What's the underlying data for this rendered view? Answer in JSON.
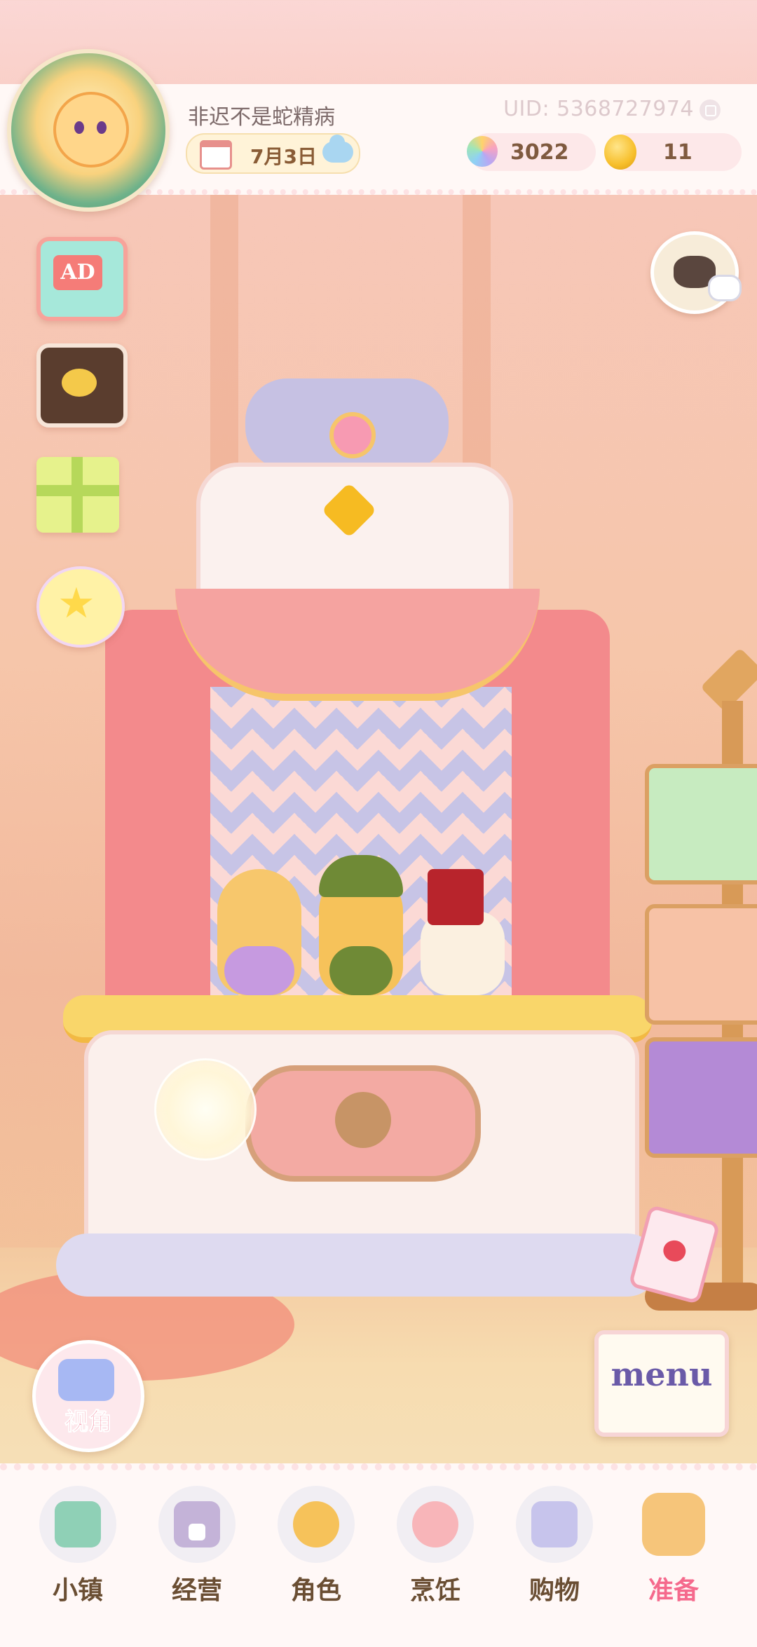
{
  "header": {
    "player_name": "非迟不是蛇精病",
    "uid": "UID: 5368727974",
    "date": "7月3日",
    "gems": "3022",
    "coins": "11"
  },
  "side_buttons": {
    "ad_label": "AD"
  },
  "view_button": {
    "label": "视角"
  },
  "menu_button": {
    "label": "menu"
  },
  "bottom_nav": {
    "items": [
      {
        "label": "小镇",
        "icon": "town-map-icon",
        "color": "#8fd0b6"
      },
      {
        "label": "经营",
        "icon": "top-hat-icon",
        "color": "#c4b3d8",
        "locked": true
      },
      {
        "label": "角色",
        "icon": "character-icon",
        "color": "#f6c25a"
      },
      {
        "label": "烹饪",
        "icon": "sandwich-icon",
        "color": "#f8b5b9"
      },
      {
        "label": "购物",
        "icon": "shopping-bag-icon",
        "color": "#c7c4ec"
      },
      {
        "label": "准备",
        "icon": "picnic-basket-icon",
        "color": "#f6c57a",
        "active": true
      }
    ]
  }
}
